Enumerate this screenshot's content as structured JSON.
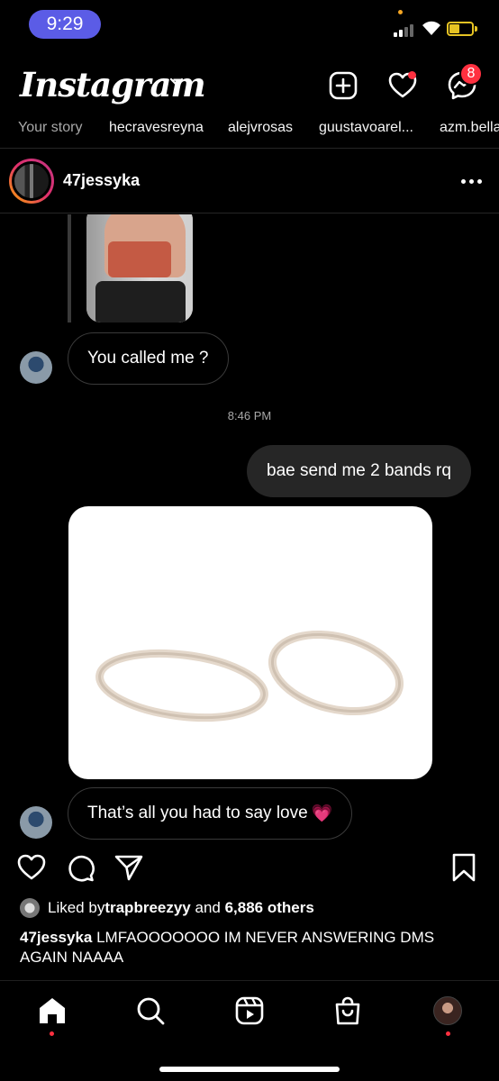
{
  "status_bar": {
    "time": "9:29"
  },
  "header": {
    "logo": "Instagram",
    "message_badge": "8"
  },
  "stories": [
    {
      "label": "Your story",
      "own": true
    },
    {
      "label": "hecravesreyna"
    },
    {
      "label": "alejvrosas"
    },
    {
      "label": "guustavoarel..."
    },
    {
      "label": "azm.bella"
    }
  ],
  "post": {
    "username": "47jessyka"
  },
  "dm": {
    "messages": [
      {
        "from": "them",
        "text": "You called me ?"
      },
      {
        "timestamp": "8:46 PM"
      },
      {
        "from": "me",
        "text": "bae send me 2 bands rq"
      },
      {
        "from": "them",
        "type": "image",
        "depicts": "rubber-bands"
      },
      {
        "from": "them",
        "text": "That’s all you had to say love",
        "emoji": "💗"
      }
    ]
  },
  "likes": {
    "prefix": "Liked by ",
    "user": "trapbreezyy",
    "middle": " and ",
    "count": "6,886 others"
  },
  "caption": {
    "username": "47jessyka",
    "text": " LMFAOOOOOOO IM NEVER ANSWERING DMS AGAIN NAAAA"
  },
  "colors": {
    "background": "#000000",
    "outgoing_bubble": "#262626",
    "accent_red": "#ff3040",
    "time_pill": "#5b5ce6",
    "battery": "#e6c323"
  },
  "nav": {
    "items": [
      "home-icon",
      "search-icon",
      "reels-icon",
      "shop-icon",
      "profile-avatar"
    ],
    "active": "home-icon"
  }
}
